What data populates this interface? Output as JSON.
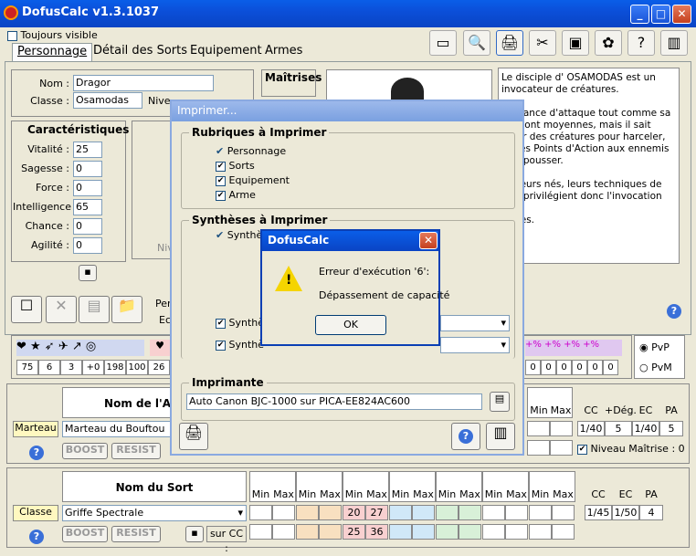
{
  "window": {
    "title": "DofusCalc v1.3.1037"
  },
  "top": {
    "always_visible": "Toujours visible"
  },
  "tabs": [
    {
      "label": "Personnage"
    },
    {
      "label": "Détail des Sorts"
    },
    {
      "label": "Equipement"
    },
    {
      "label": "Armes"
    }
  ],
  "identity": {
    "name_label": "Nom :",
    "name_value": "Dragor",
    "class_label": "Classe :",
    "class_value": "Osamodas",
    "level_label_partial": "Nive"
  },
  "maitrises": {
    "title": "Maîtrises"
  },
  "description": {
    "lines": [
      "Le disciple d' OSAMODAS est un",
      "invocateur de créatures.",
      "",
      "...issance d'attaque tout comme sa",
      "...e sont moyennes, mais il sait",
      "...uer des créatures pour harceler,",
      "... des Points d'Action aux ennemis",
      "... repousser.",
      "",
      "...ateurs nés, leurs techniques de",
      "...at privilégient donc l'invocation de",
      "...ures."
    ]
  },
  "characteristics": {
    "title": "Caractéristiques",
    "rows": [
      {
        "label": "Vitalité :",
        "value": "25"
      },
      {
        "label": "Sagesse :",
        "value": "0"
      },
      {
        "label": "Force :",
        "value": "0"
      },
      {
        "label": "Intelligence :",
        "value": "65"
      },
      {
        "label": "Chance :",
        "value": "0"
      },
      {
        "label": "Agilité :",
        "value": "0"
      }
    ]
  },
  "partial_labels": {
    "per": "Per",
    "ec": "Ec",
    "niv": "Niv"
  },
  "stats_strip": {
    "values": [
      "75",
      "6",
      "3",
      "+0",
      "198",
      "100",
      "26"
    ],
    "right_values": [
      "0",
      "0",
      "0",
      "0",
      "0",
      "0"
    ]
  },
  "mode": {
    "pvp": "PvP",
    "pvm": "PvM"
  },
  "weapon": {
    "header_partial": "Nom de l'A",
    "type_label": "Marteau",
    "name": "Marteau du Bouftou",
    "boost": "BOOST",
    "resist": "RESIST",
    "min": "Min",
    "max": "Max",
    "cc_header": "CC",
    "deg_header": "+Dég.",
    "ec_header": "EC",
    "pa_header": "PA",
    "cc": "1/40",
    "deg": "5",
    "ec": "1/40",
    "pa": "5",
    "niveau_maitrise": "Niveau Maîtrise : 0"
  },
  "spell": {
    "header": "Nom du Sort",
    "class_label": "Classe",
    "name": "Griffe Spectrale",
    "boost": "BOOST",
    "resist": "RESIST",
    "min": "Min",
    "max": "Max",
    "sur_cc": "sur CC :",
    "fire_min": "20",
    "fire_max": "27",
    "fire_min_cc": "25",
    "fire_max_cc": "36",
    "cc_header": "CC",
    "ec_header": "EC",
    "pa_header": "PA",
    "cc": "1/45",
    "ec": "1/50",
    "pa": "4"
  },
  "print_dialog": {
    "title": "Imprimer...",
    "rubriques_title": "Rubriques à Imprimer",
    "rubriques": [
      {
        "label": "Personnage",
        "style": "tick"
      },
      {
        "label": "Sorts",
        "style": "box"
      },
      {
        "label": "Equipement",
        "style": "box"
      },
      {
        "label": "Arme",
        "style": "box"
      }
    ],
    "syntheses_title": "Synthèses à Imprimer",
    "synth_partial": "Synthè",
    "synth_partial2": "Synthè",
    "synth_partial3": "Synthè",
    "printer_title": "Imprimante",
    "printer_value": "Auto Canon BJC-1000 sur PICA-EE824AC600"
  },
  "error_dialog": {
    "title": "DofusCalc",
    "line1": "Erreur d'exécution '6':",
    "line2": "Dépassement de capacité",
    "ok": "OK"
  },
  "colors": {
    "titlebar": "#0b4fd9",
    "fire": "#f8d0d0",
    "water": "#d0e8f8",
    "earth": "#f8e0c0",
    "air": "#d8f0d8"
  }
}
